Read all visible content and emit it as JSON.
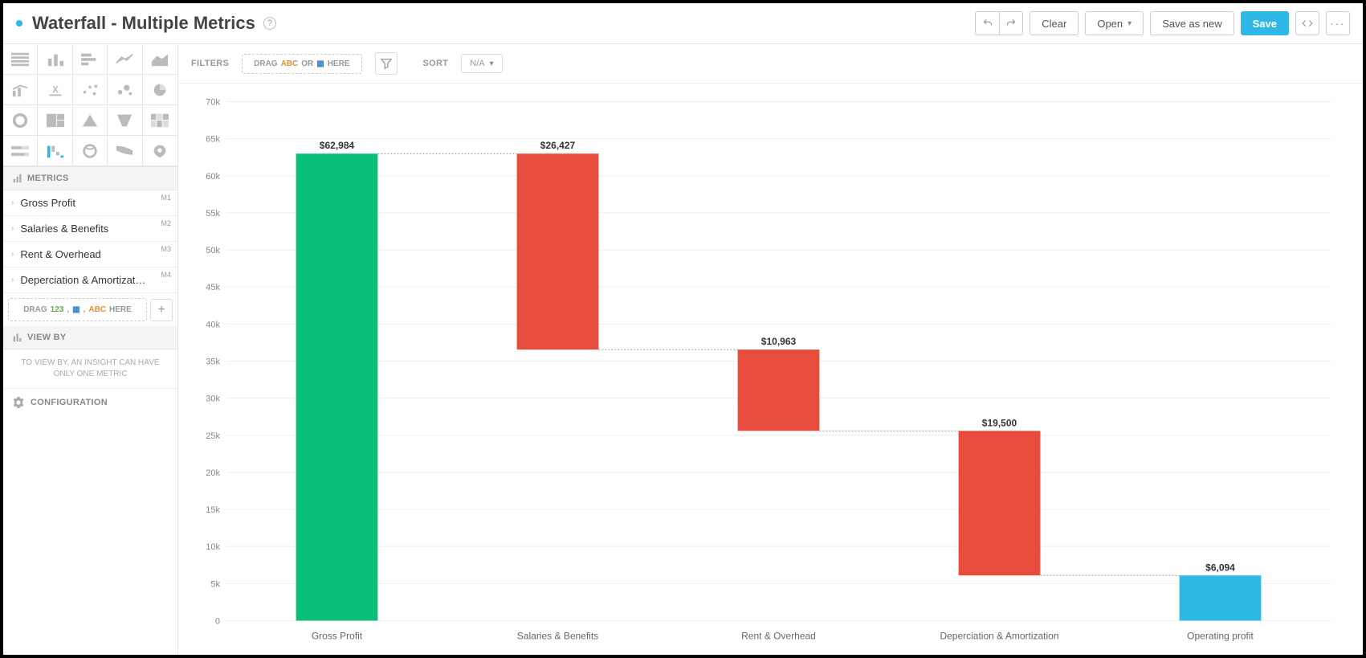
{
  "header": {
    "title": "Waterfall - Multiple Metrics",
    "clear": "Clear",
    "open": "Open",
    "save_as_new": "Save as new",
    "save": "Save"
  },
  "sidebar": {
    "metrics_label": "METRICS",
    "metrics": [
      {
        "name": "Gross Profit",
        "badge": "M1"
      },
      {
        "name": "Salaries & Benefits",
        "badge": "M2"
      },
      {
        "name": "Rent & Overhead",
        "badge": "M3"
      },
      {
        "name": "Deperciation & Amortizat…",
        "badge": "M4"
      }
    ],
    "drag1": "DRAG",
    "drag_here": "HERE",
    "viewby_label": "VIEW BY",
    "viewby_msg": "TO VIEW BY, AN INSIGHT CAN HAVE ONLY ONE METRIC",
    "configuration": "CONFIGURATION"
  },
  "toolbar": {
    "filters_label": "FILTERS",
    "drag": "DRAG",
    "or": "OR",
    "here": "HERE",
    "sort_label": "SORT",
    "sort_value": "N/A"
  },
  "chart_data": {
    "type": "bar",
    "subtype": "waterfall",
    "categories": [
      "Gross Profit",
      "Salaries & Benefits",
      "Rent & Overhead",
      "Deperciation & Amortization",
      "Operating profit"
    ],
    "labels": [
      "$62,984",
      "$26,427",
      "$10,963",
      "$19,500",
      "$6,094"
    ],
    "values": [
      62984,
      -26427,
      -10963,
      -19500,
      6094
    ],
    "bar_types": [
      "start",
      "decrease",
      "decrease",
      "decrease",
      "total"
    ],
    "colors": {
      "start": "#0ABF77",
      "decrease": "#E74C3C",
      "total": "#2EB8E6"
    },
    "ylim": [
      0,
      70000
    ],
    "yticks": [
      0,
      5000,
      10000,
      15000,
      20000,
      25000,
      30000,
      35000,
      40000,
      45000,
      50000,
      55000,
      60000,
      65000,
      70000
    ],
    "ytick_labels": [
      "0",
      "5k",
      "10k",
      "15k",
      "20k",
      "25k",
      "30k",
      "35k",
      "40k",
      "45k",
      "50k",
      "55k",
      "60k",
      "65k",
      "70k"
    ],
    "xlabel": "",
    "ylabel": ""
  }
}
